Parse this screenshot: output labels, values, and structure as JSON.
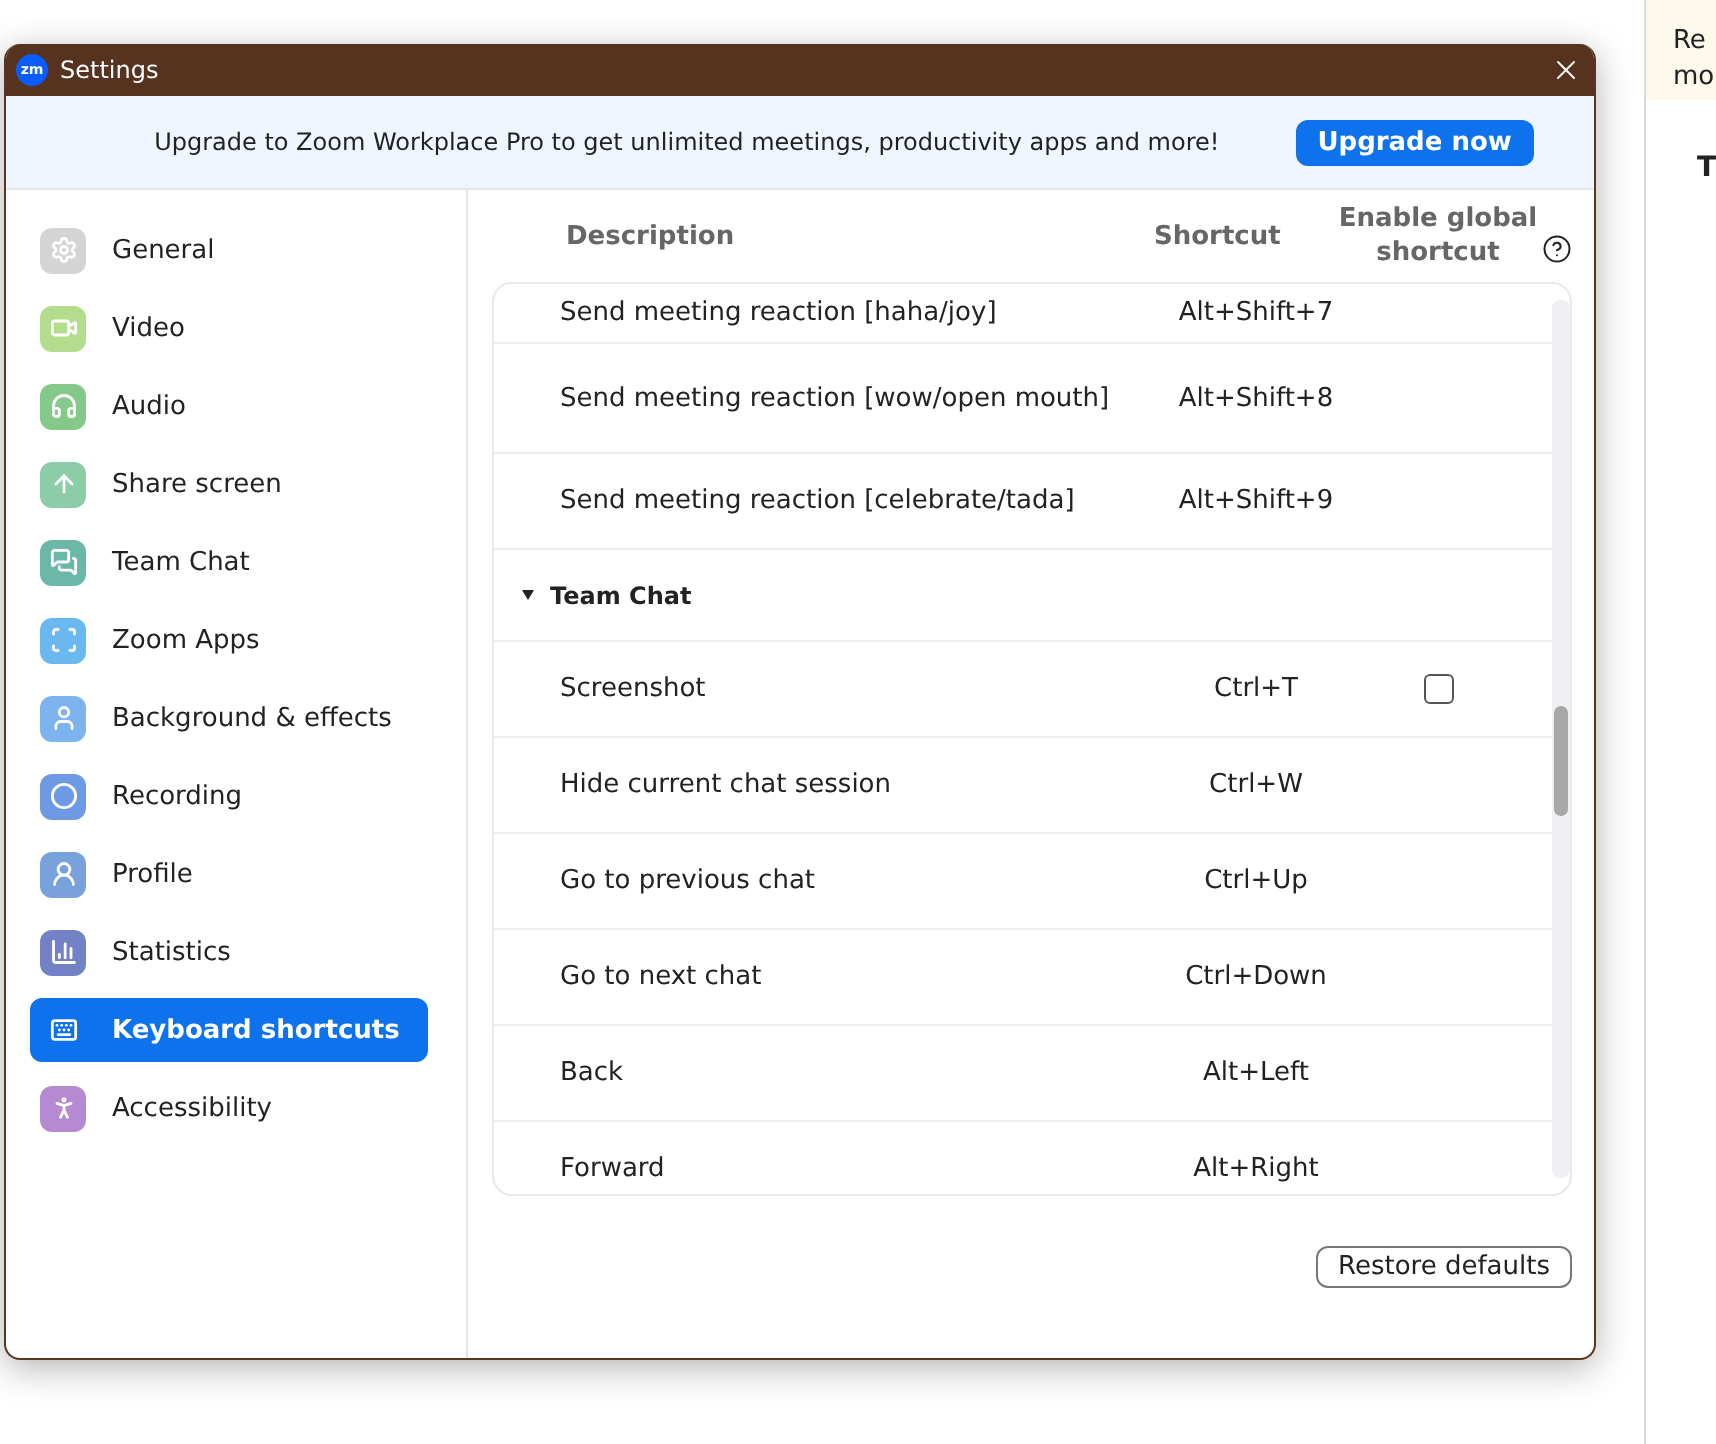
{
  "window": {
    "title": "Settings",
    "logo": "zm"
  },
  "banner": {
    "text": "Upgrade to Zoom Workplace Pro to get unlimited meetings, productivity apps and more!",
    "button": "Upgrade now"
  },
  "sidebar": {
    "items": [
      {
        "label": "General",
        "selected": false,
        "color": "#d4d4d4"
      },
      {
        "label": "Video",
        "selected": false,
        "color": "#b3dc8c"
      },
      {
        "label": "Audio",
        "selected": false,
        "color": "#84c98a"
      },
      {
        "label": "Share screen",
        "selected": false,
        "color": "#8ccca6"
      },
      {
        "label": "Team Chat",
        "selected": false,
        "color": "#6bb8a8"
      },
      {
        "label": "Zoom Apps",
        "selected": false,
        "color": "#6ab8f0"
      },
      {
        "label": "Background & effects",
        "selected": false,
        "color": "#7db3ee"
      },
      {
        "label": "Recording",
        "selected": false,
        "color": "#6d9ae2"
      },
      {
        "label": "Profile",
        "selected": false,
        "color": "#79a2dc"
      },
      {
        "label": "Statistics",
        "selected": false,
        "color": "#7382c7"
      },
      {
        "label": "Keyboard shortcuts",
        "selected": true,
        "color": "#0e72ed"
      },
      {
        "label": "Accessibility",
        "selected": false,
        "color": "#b58ad2"
      }
    ]
  },
  "table": {
    "columns": [
      "Description",
      "Shortcut",
      "Enable global shortcut"
    ],
    "rows": [
      {
        "kind": "shortcut",
        "description": "Send meeting reaction [haha/joy]",
        "shortcut": "Alt+Shift+7"
      },
      {
        "kind": "shortcut",
        "description": "Send meeting reaction [wow/open mouth]",
        "shortcut": "Alt+Shift+8"
      },
      {
        "kind": "shortcut",
        "description": "Send meeting reaction [celebrate/tada]",
        "shortcut": "Alt+Shift+9"
      },
      {
        "kind": "section",
        "description": "Team Chat",
        "expanded": true
      },
      {
        "kind": "shortcut",
        "description": "Screenshot",
        "shortcut": "Ctrl+T",
        "global": {
          "checked": false
        }
      },
      {
        "kind": "shortcut",
        "description": "Hide current chat session",
        "shortcut": "Ctrl+W"
      },
      {
        "kind": "shortcut",
        "description": "Go to previous chat",
        "shortcut": "Ctrl+Up"
      },
      {
        "kind": "shortcut",
        "description": "Go to next chat",
        "shortcut": "Ctrl+Down"
      },
      {
        "kind": "shortcut",
        "description": "Back",
        "shortcut": "Alt+Left"
      },
      {
        "kind": "shortcut",
        "description": "Forward",
        "shortcut": "Alt+Right"
      }
    ]
  },
  "restore_button": "Restore defaults",
  "background_window": {
    "notice_lines": [
      "Re",
      "mo"
    ],
    "heading": "T"
  }
}
